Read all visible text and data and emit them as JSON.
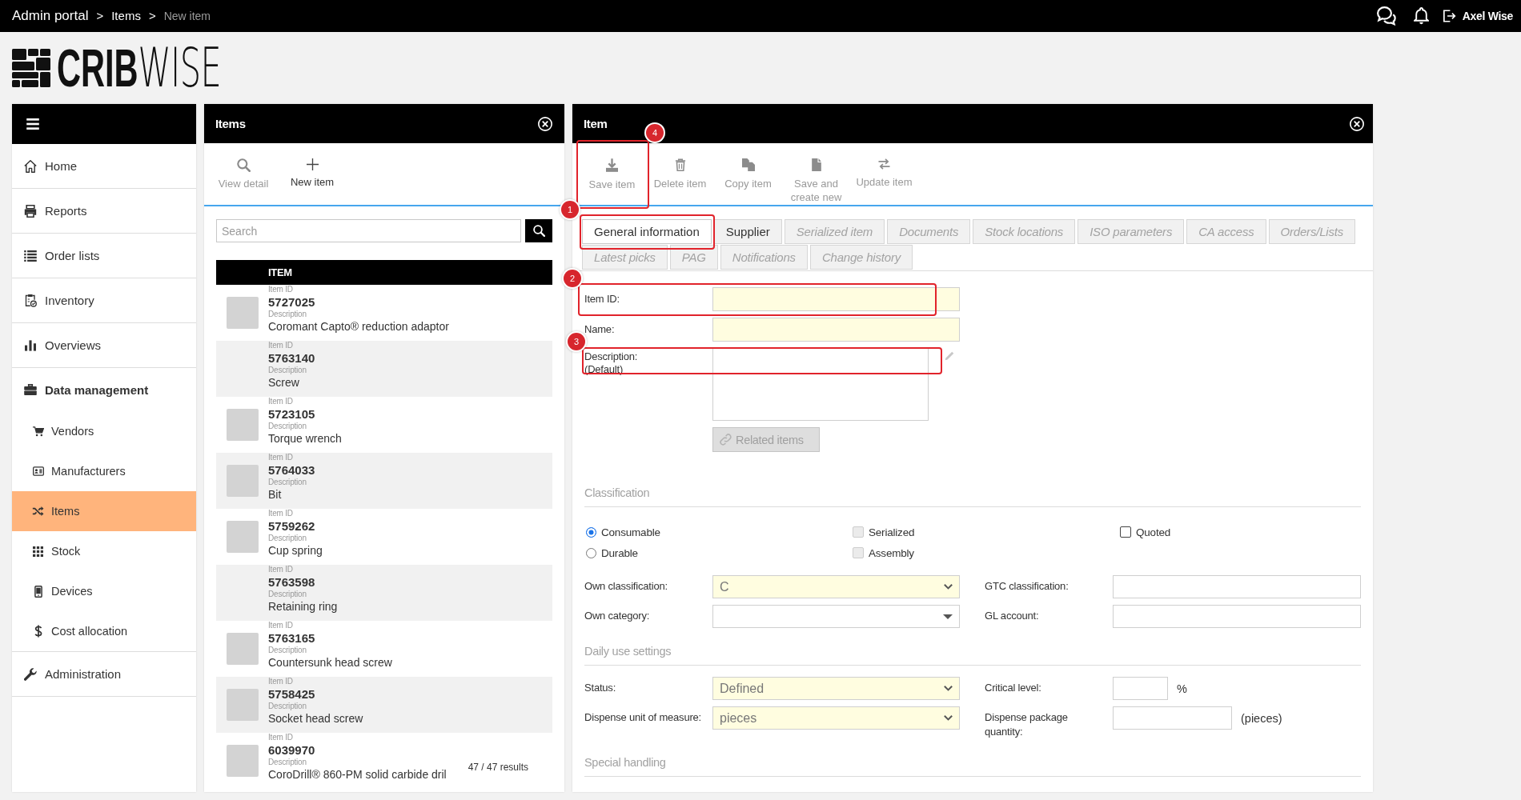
{
  "top_bar": {
    "breadcrumb": [
      {
        "label": "Admin portal",
        "current": false
      },
      {
        "label": "Items",
        "current": false
      },
      {
        "label": "New item",
        "current": true
      }
    ],
    "separator": ">",
    "user": "Axel Wise"
  },
  "logo": {
    "wordmark": "**CRIB**WISE"
  },
  "sidebar": {
    "items": [
      {
        "label": "Home",
        "selected": false
      },
      {
        "label": "Reports",
        "selected": false
      },
      {
        "label": "Order lists",
        "selected": false
      },
      {
        "label": "Inventory",
        "selected": false
      },
      {
        "label": "Overviews",
        "selected": false
      },
      {
        "label": "Data management",
        "selected": false,
        "children": [
          {
            "label": "Vendors",
            "selected": false
          },
          {
            "label": "Manufacturers",
            "selected": false
          },
          {
            "label": "Items",
            "selected": true
          },
          {
            "label": "Stock",
            "selected": false
          },
          {
            "label": "Devices",
            "selected": false
          },
          {
            "label": "Cost allocation",
            "selected": false
          }
        ]
      },
      {
        "label": "Administration",
        "selected": false
      }
    ]
  },
  "items_panel": {
    "title": "Items",
    "toolbar": [
      {
        "label": "View detail",
        "disabled": true
      },
      {
        "label": "New item",
        "disabled": false
      }
    ],
    "search": {
      "placeholder": "Search"
    },
    "column": "ITEM",
    "rows": [
      {
        "id_label": "Item ID",
        "id": "5727025",
        "description_label": "Description",
        "description": "Coromant Capto® reduction adaptor",
        "photo": true,
        "selected": false
      },
      {
        "id_label": "Item ID",
        "id": "5763140",
        "description_label": "Description",
        "description": "Screw",
        "photo": false,
        "selected": false
      },
      {
        "id_label": "Item ID",
        "id": "5723105",
        "description_label": "Description",
        "description": "Torque wrench",
        "photo": true,
        "selected": false
      },
      {
        "id_label": "Item ID",
        "id": "5764033",
        "description_label": "Description",
        "description": "Bit",
        "photo": true,
        "selected": false
      },
      {
        "id_label": "Item ID",
        "id": "5759262",
        "description_label": "Description",
        "description": "Cup spring",
        "photo": true,
        "selected": false
      },
      {
        "id_label": "Item ID",
        "id": "5763598",
        "description_label": "Description",
        "description": "Retaining ring",
        "photo": false,
        "selected": false
      },
      {
        "id_label": "Item ID",
        "id": "5763165",
        "description_label": "Description",
        "description": "Countersunk head screw",
        "photo": true,
        "selected": false
      },
      {
        "id_label": "Item ID",
        "id": "5758425",
        "description_label": "Description",
        "description": "Socket head screw",
        "photo": true,
        "selected": false
      },
      {
        "id_label": "Item ID",
        "id": "6039970",
        "description_label": "Description",
        "description": "CoroDrill® 860-PM solid carbide dril",
        "photo": true,
        "selected": false
      }
    ],
    "results": "47 / 47 results"
  },
  "item_panel": {
    "title": "Item",
    "toolbar": [
      {
        "label": "Save item",
        "disabled": true,
        "callout": "4"
      },
      {
        "label": "Delete item",
        "disabled": true
      },
      {
        "label": "Copy item",
        "disabled": true
      },
      {
        "label": "Save and create new",
        "disabled": true
      },
      {
        "label": "Update item",
        "disabled": true
      }
    ],
    "tabs": [
      {
        "label": "General information",
        "selected": true,
        "disabled": false,
        "callout": "1"
      },
      {
        "label": "Supplier",
        "selected": false,
        "disabled": false
      },
      {
        "label": "Serialized item",
        "selected": false,
        "disabled": true
      },
      {
        "label": "Documents",
        "selected": false,
        "disabled": true
      },
      {
        "label": "Stock locations",
        "selected": false,
        "disabled": true
      },
      {
        "label": "ISO parameters",
        "selected": false,
        "disabled": true
      },
      {
        "label": "CA access",
        "selected": false,
        "disabled": true
      },
      {
        "label": "Orders/Lists",
        "selected": false,
        "disabled": true
      },
      {
        "label": "Latest picks",
        "selected": false,
        "disabled": true
      },
      {
        "label": "PAG",
        "selected": false,
        "disabled": true
      },
      {
        "label": "Notifications",
        "selected": false,
        "disabled": true
      },
      {
        "label": "Change history",
        "selected": false,
        "disabled": true
      }
    ],
    "fields": [
      {
        "kind": "text",
        "label": "Item ID:",
        "required": true,
        "callout": "2"
      },
      {
        "kind": "text",
        "label": "Name:",
        "required": true
      },
      {
        "kind": "textarea",
        "label": "Description:",
        "sublabel": "(Default)",
        "required": false,
        "callout": "3"
      }
    ],
    "related_items": {
      "label": "Related items",
      "disabled": true
    },
    "sections": [
      {
        "title": "Classification",
        "options": [
          {
            "kind": "radio",
            "label": "Consumable",
            "selected": true,
            "disabled": false
          },
          {
            "kind": "radio",
            "label": "Durable",
            "selected": false,
            "disabled": false
          },
          {
            "kind": "checkbox",
            "label": "Serialized",
            "checked": false,
            "disabled": true
          },
          {
            "kind": "checkbox",
            "label": "Assembly",
            "checked": false,
            "disabled": true
          },
          {
            "kind": "checkbox",
            "label": "Quoted",
            "checked": false,
            "disabled": false
          }
        ],
        "fields": [
          {
            "kind": "select",
            "label": "Own classification:",
            "value": "C",
            "required": true
          },
          {
            "kind": "text",
            "label": "GTC classification:",
            "required": false
          },
          {
            "kind": "combobox",
            "label": "Own category:",
            "required": false
          },
          {
            "kind": "text",
            "label": "GL account:",
            "required": false
          }
        ]
      },
      {
        "title": "Daily use settings",
        "fields": [
          {
            "kind": "select",
            "label": "Status:",
            "value": "Defined",
            "required": true
          },
          {
            "kind": "percent",
            "label": "Critical level:",
            "unit": "%",
            "required": false
          },
          {
            "kind": "select",
            "label": "Dispense unit of measure:",
            "value": "pieces",
            "required": true
          },
          {
            "kind": "quantity",
            "label": "Dispense package quantity:",
            "unit": "(pieces)",
            "required": false
          }
        ]
      },
      {
        "title": "Special handling"
      }
    ]
  }
}
